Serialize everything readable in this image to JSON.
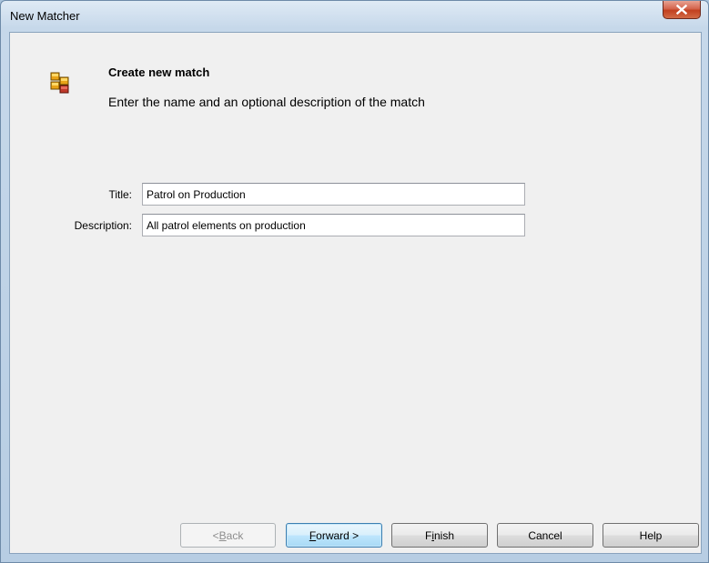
{
  "window": {
    "title": "New Matcher"
  },
  "header": {
    "title": "Create new match",
    "subtitle": "Enter the name and an optional description of the match"
  },
  "form": {
    "title_label": "Title:",
    "title_value": "Patrol on Production",
    "description_label": "Description:",
    "description_value": "All patrol elements on production"
  },
  "buttons": {
    "back_mnemonic": "B",
    "back_rest": "ack",
    "back_prefix": "< ",
    "forward_mnemonic": "F",
    "forward_rest": "orward >",
    "finish_pre": "F",
    "finish_mnemonic": "i",
    "finish_rest": "nish",
    "cancel_label": "Cancel",
    "help_label": "Help"
  },
  "icons": {
    "close": "close-icon",
    "header": "cubes-icon"
  }
}
